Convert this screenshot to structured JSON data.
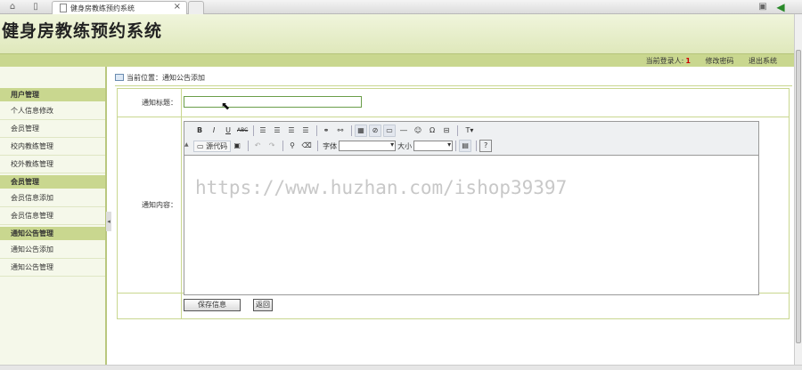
{
  "browser": {
    "tab_title": "健身房教练预约系统",
    "close_glyph": "×"
  },
  "app": {
    "title": "健身房教练预约系统"
  },
  "topbar": {
    "login_label": "当前登录人:",
    "login_count": "1",
    "change_password": "修改密码",
    "logout": "退出系统"
  },
  "sidebar": {
    "groups": [
      {
        "label": "用户管理",
        "items": [
          "个人信息修改",
          "会员管理",
          "校内教练管理",
          "校外教练管理"
        ]
      },
      {
        "label": "会员管理",
        "items": [
          "会员信息添加",
          "会员信息管理"
        ]
      },
      {
        "label": "通知公告管理",
        "items": [
          "通知公告添加",
          "通知公告管理"
        ]
      }
    ]
  },
  "breadcrumb": {
    "text": "当前位置：通知公告添加"
  },
  "form": {
    "title_label": "通知标题：",
    "title_value": "",
    "content_label": "通知内容：",
    "save_button": "保存信息",
    "back_button": "返回"
  },
  "editor": {
    "source_button": "源代码",
    "font_label": "字体",
    "size_label": "大小",
    "watermark": "https://www.huzhan.com/ishop39397"
  }
}
